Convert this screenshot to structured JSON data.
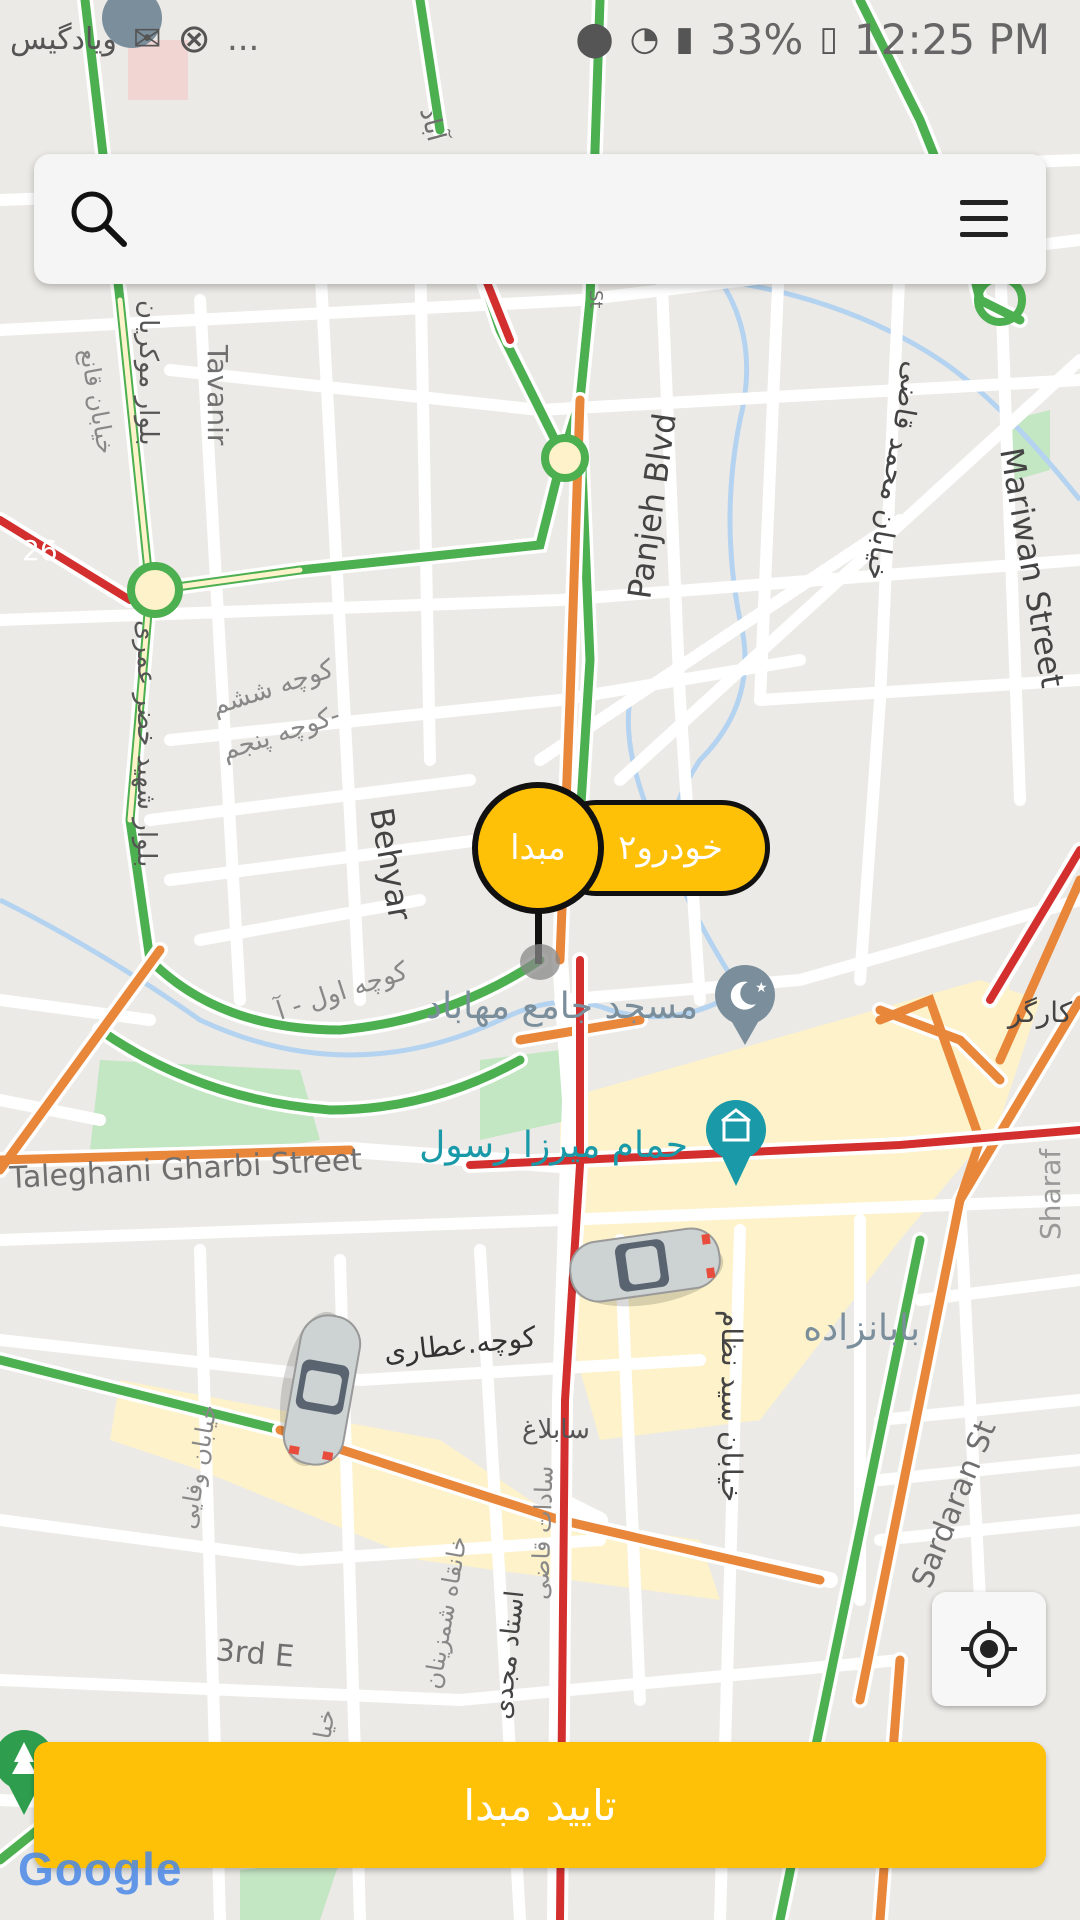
{
  "status_bar": {
    "left_text": "ویادگیس",
    "more": "...",
    "battery": "33%",
    "time": "12:25 PM"
  },
  "search": {
    "icon": "search-icon",
    "menu_icon": "menu-icon"
  },
  "pin": {
    "origin_label": "مبدا",
    "cars_label": "۲خودرو"
  },
  "buttons": {
    "confirm": "تایید مبدا"
  },
  "map": {
    "streets": {
      "taleghani": "Taleghani Gharbi Street",
      "panjeh": "Panjeh Blvd",
      "mariwan": "Mariwan Street",
      "behyar": "Behyar",
      "tavanir": "Tavanir",
      "sardaran": "Sardaran St",
      "third_e": "3rd E",
      "sharaf": "Sharaf",
      "kargar": "کارگر",
      "abad": "آباد",
      "st": "St",
      "kucheh_attari": "کوچه.عطاری",
      "kucheh_sheshom": "کوچه ششم",
      "kucheh_panjom": "کوچه پنجم-",
      "kucheh_aval": "کوچه اول - آ",
      "sablagh": "سابلاغ",
      "saeed_nezam": "خیابان سید نظام",
      "mohammad_ghazi": "خیابان محمد قاضی",
      "ghane": "خیابان قانع",
      "khezr_omari": "بلوار شهید خضر عمری",
      "moukriyan": "بلوار موکریان",
      "vafaei": "خیابان وفایی",
      "khanghah": "خانقاه شمزینان",
      "ostad_mojdi": "استاد مجدی",
      "khiaban": "خیا",
      "tajzade": "سادات قاضی"
    },
    "places": {
      "mosque": "مسجد جامع مهاباد",
      "bath": "حمام میرزا رسول",
      "babanzadeh": "بابانزاده"
    },
    "highway_number": "26"
  },
  "google": "Google",
  "colors": {
    "accent": "#FFC107",
    "road_green": "#4caf50",
    "road_orange": "#e8863a",
    "road_red": "#d32f2f",
    "water": "#b4d3f0",
    "park": "#c3e6c3",
    "commercial": "#fdf2c9",
    "place_teal": "#1a9aa8",
    "place_gray": "#7a8e9c"
  }
}
